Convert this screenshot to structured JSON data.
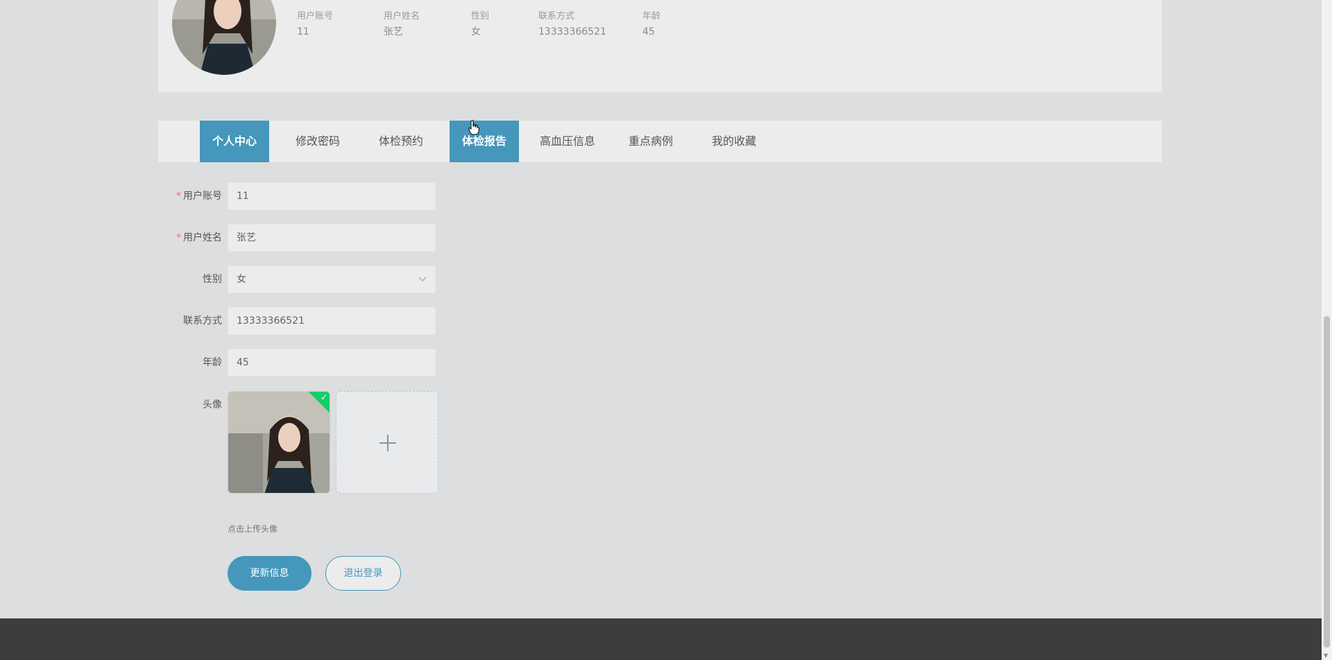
{
  "profile": {
    "fields": [
      {
        "label": "用户账号",
        "value": "11"
      },
      {
        "label": "用户姓名",
        "value": "张艺"
      },
      {
        "label": "性别",
        "value": "女"
      },
      {
        "label": "联系方式",
        "value": "13333366521"
      },
      {
        "label": "年龄",
        "value": "45"
      }
    ]
  },
  "tabs": [
    {
      "label": "个人中心",
      "active": true
    },
    {
      "label": "修改密码",
      "active": false
    },
    {
      "label": "体检预约",
      "active": false
    },
    {
      "label": "体检报告",
      "active": true
    },
    {
      "label": "高血压信息",
      "active": false
    },
    {
      "label": "重点病例",
      "active": false
    },
    {
      "label": "我的收藏",
      "active": false
    }
  ],
  "form": {
    "account": {
      "label": "用户账号",
      "value": "11",
      "required": "*"
    },
    "name": {
      "label": "用户姓名",
      "value": "张艺",
      "required": "*"
    },
    "gender": {
      "label": "性别",
      "value": "女"
    },
    "phone": {
      "label": "联系方式",
      "value": "13333366521"
    },
    "age": {
      "label": "年龄",
      "value": "45"
    },
    "avatar": {
      "label": "头像"
    },
    "upload_tip": "点击上传头像"
  },
  "buttons": {
    "update": "更新信息",
    "logout": "退出登录"
  },
  "colors": {
    "accent": "#4597bb",
    "success": "#13ce66",
    "footer": "#3d3d3d"
  }
}
